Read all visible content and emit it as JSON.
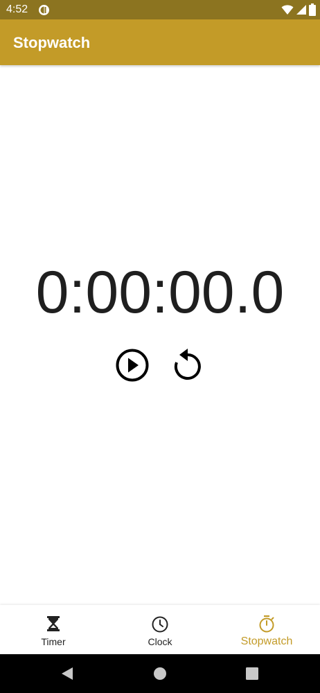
{
  "status_bar": {
    "time": "4:52",
    "app_icon": "half-circle-app-icon",
    "icons": [
      "wifi-icon",
      "signal-icon",
      "battery-icon"
    ]
  },
  "app_bar": {
    "title": "Stopwatch"
  },
  "stopwatch": {
    "time": "0:00:00.0",
    "play_icon": "play-circle-icon",
    "reset_icon": "reset-icon"
  },
  "bottom_nav": {
    "active_tab": "Stopwatch",
    "items": [
      {
        "label": "Timer",
        "icon": "hourglass-icon"
      },
      {
        "label": "Clock",
        "icon": "clock-icon"
      },
      {
        "label": "Stopwatch",
        "icon": "stopwatch-icon"
      }
    ]
  },
  "system_nav": {
    "buttons": [
      "back-icon",
      "home-icon",
      "recents-icon"
    ]
  },
  "colors": {
    "status_bar": "#8c7420",
    "app_bar": "#c39b28",
    "accent": "#c39b28",
    "text_dark": "#1f1f1f",
    "system_nav": "#000000"
  }
}
